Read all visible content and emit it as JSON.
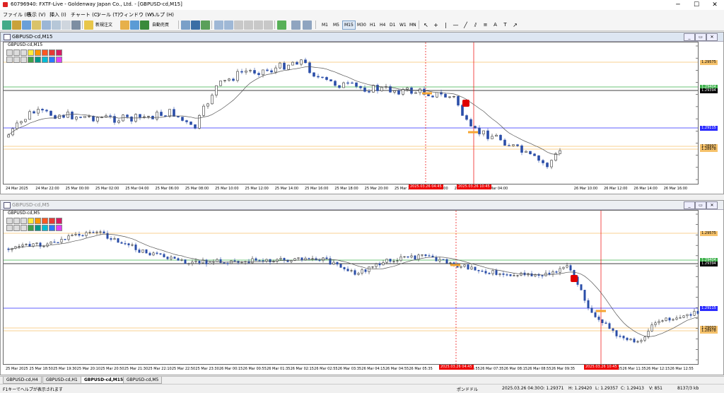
{
  "window": {
    "title": "60796940: FXTF-Live - Goldenway Japan Co., Ltd. - [GBPUSD-cd,M15]",
    "minimize": "─",
    "maximize": "☐",
    "close": "✕"
  },
  "menu": [
    "ファイル (F)",
    "表示 (V)",
    "挿入 (I)",
    "チャート (C)",
    "ツール (T)",
    "ウィンドウ (W)",
    "ヘルプ (H)"
  ],
  "toolbar": {
    "new_order": "新規注文",
    "auto_trade": "自動売買",
    "timeframes": [
      "M1",
      "M5",
      "M15",
      "M30",
      "H1",
      "H4",
      "D1",
      "W1",
      "MN"
    ],
    "active_timeframe": "M15"
  },
  "chart1": {
    "caption": "GBPUSD-cd,M15",
    "symbol": "GBPUSD-cd,M15",
    "prices": [
      "1.29715",
      "1.29625",
      "1.29535",
      "1.29445",
      "1.29355",
      "1.29265",
      "1.29175",
      "1.29080",
      "1.28990",
      "1.28900",
      "1.28810",
      "1.28720"
    ],
    "price_boxes": [
      {
        "text": "1.29575",
        "color": "#f6c26b"
      },
      {
        "text": "1.29404",
        "color": "#3cb04a"
      },
      {
        "text": "1.29394",
        "color": "#000000"
      },
      {
        "text": "1.29115",
        "color": "#2b2bff"
      },
      {
        "text": "1.28997",
        "color": "#f6c26b"
      },
      {
        "text": "1.28978",
        "color": "#f6c26b"
      }
    ],
    "times": [
      "24 Mar 2025",
      "24 Mar 22:00",
      "25 Mar 00:00",
      "25 Mar 02:00",
      "25 Mar 04:00",
      "25 Mar 06:00",
      "25 Mar 08:00",
      "25 Mar 10:00",
      "25 Mar 12:00",
      "25 Mar 14:00",
      "25 Mar 16:00",
      "25 Mar 18:00",
      "25 Mar 20:00",
      "25 Mar 22:00",
      "26 Mar 00:00",
      "26 Mar 02:00",
      "26 Mar 04:00",
      "",
      "",
      "26 Mar 10:00",
      "26 Mar 12:00",
      "26 Mar 14:00",
      "26 Mar 16:00"
    ],
    "time_boxes": [
      "2025.03.26 04:45",
      "2025.03.26 10:45"
    ]
  },
  "chart2": {
    "caption": "GBPUSD-cd,M5",
    "symbol": "GBPUSD-cd,M5",
    "prices": [
      "1.29635",
      "1.29575",
      "1.29515",
      "1.29475",
      "1.29415",
      "1.29355",
      "1.29315",
      "1.29255",
      "1.29195",
      "1.29155",
      "1.29095",
      "1.29035",
      "1.28975",
      "1.28915",
      "1.28855"
    ],
    "price_boxes": [
      {
        "text": "1.29575",
        "color": "#f6c26b"
      },
      {
        "text": "1.29404",
        "color": "#3cb04a"
      },
      {
        "text": "1.29394",
        "color": "#000000"
      },
      {
        "text": "1.29115",
        "color": "#2b2bff"
      },
      {
        "text": "1.29003",
        "color": "#f6c26b"
      },
      {
        "text": "1.28978",
        "color": "#f6c26b"
      }
    ],
    "times": [
      "25 Mar 2025",
      "25 Mar 18:50",
      "25 Mar 19:30",
      "25 Mar 20:10",
      "25 Mar 20:50",
      "25 Mar 21:30",
      "25 Mar 22:10",
      "25 Mar 22:50",
      "25 Mar 23:30",
      "26 Mar 00:15",
      "26 Mar 00:55",
      "26 Mar 01:35",
      "26 Mar 02:15",
      "26 Mar 02:55",
      "26 Mar 03:35",
      "26 Mar 04:15",
      "26 Mar 04:55",
      "26 Mar 05:35",
      "",
      "26 Mar 06:55",
      "26 Mar 07:35",
      "26 Mar 08:15",
      "26 Mar 08:55",
      "26 Mar 09:35",
      "",
      "26 Mar 10:55",
      "26 Mar 11:35",
      "26 Mar 12:15",
      "26 Mar 12:55"
    ],
    "time_boxes": [
      "2025.03.26 04:45",
      "2025.03.26 10:45"
    ]
  },
  "tabs": [
    "GBPUSD-cd,H4",
    "GBPUSD-cd,H1",
    "GBPUSD-cd,M15",
    "GBPUSD-cd,M5"
  ],
  "active_tab": "GBPUSD-cd,M15",
  "status": {
    "help": "F1キーでヘルプが表示されます",
    "profile": "ポンドドル",
    "datetime": "2025.03.26 04:30",
    "open": "O: 1.29371",
    "high": "H: 1.29420",
    "low": "L: 1.29357",
    "close": "C: 1.29413",
    "volume": "V: 851",
    "traffic": "8137/3 kb"
  },
  "colors": {
    "bull": "#3a3a3a",
    "bear": "#2b4ea8",
    "ma": "#555555",
    "signal_red": "#e00000",
    "signal_orange": "#f6a531"
  }
}
